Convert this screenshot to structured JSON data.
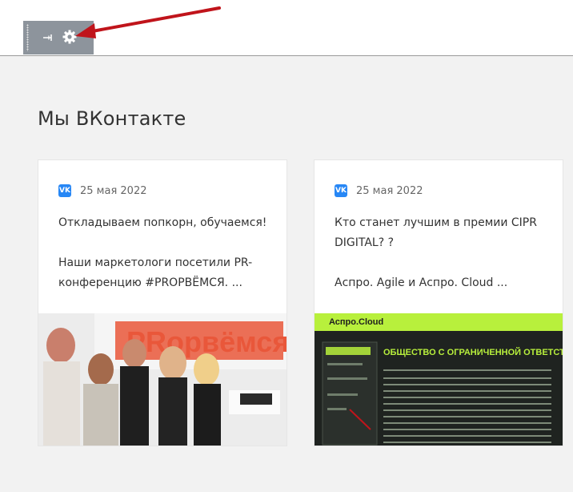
{
  "section": {
    "title": "Мы ВКонтакте"
  },
  "toolbar": {
    "pin_icon": "pin-icon",
    "settings_icon": "gear-icon"
  },
  "posts": [
    {
      "icon": "vk-icon",
      "icon_text": "VK",
      "date": "25 мая 2022",
      "paragraphs": [
        "Откладываем попкорн, обучаемся!",
        "Наши маркетологи посетили PR-конференцию #PROPВЁМСЯ. ..."
      ],
      "image_text": "PRорвёмся"
    },
    {
      "icon": "vk-icon",
      "icon_text": "VK",
      "date": "25 мая 2022",
      "paragraphs": [
        "Кто станет лучшим в премии CIPR DIGITAL? ?",
        "Аспро. Agile и Аспро. Cloud ..."
      ],
      "image_header": "Аспро.Cloud",
      "image_heading": "ОБЩЕСТВО С ОГРАНИЧЕННОЙ ОТВЕТСТВЕННОСТЬЮ \"АСПРО\""
    }
  ],
  "colors": {
    "accent": "#2787f5",
    "arrow": "#c0141b",
    "lime": "#b8f03c"
  }
}
